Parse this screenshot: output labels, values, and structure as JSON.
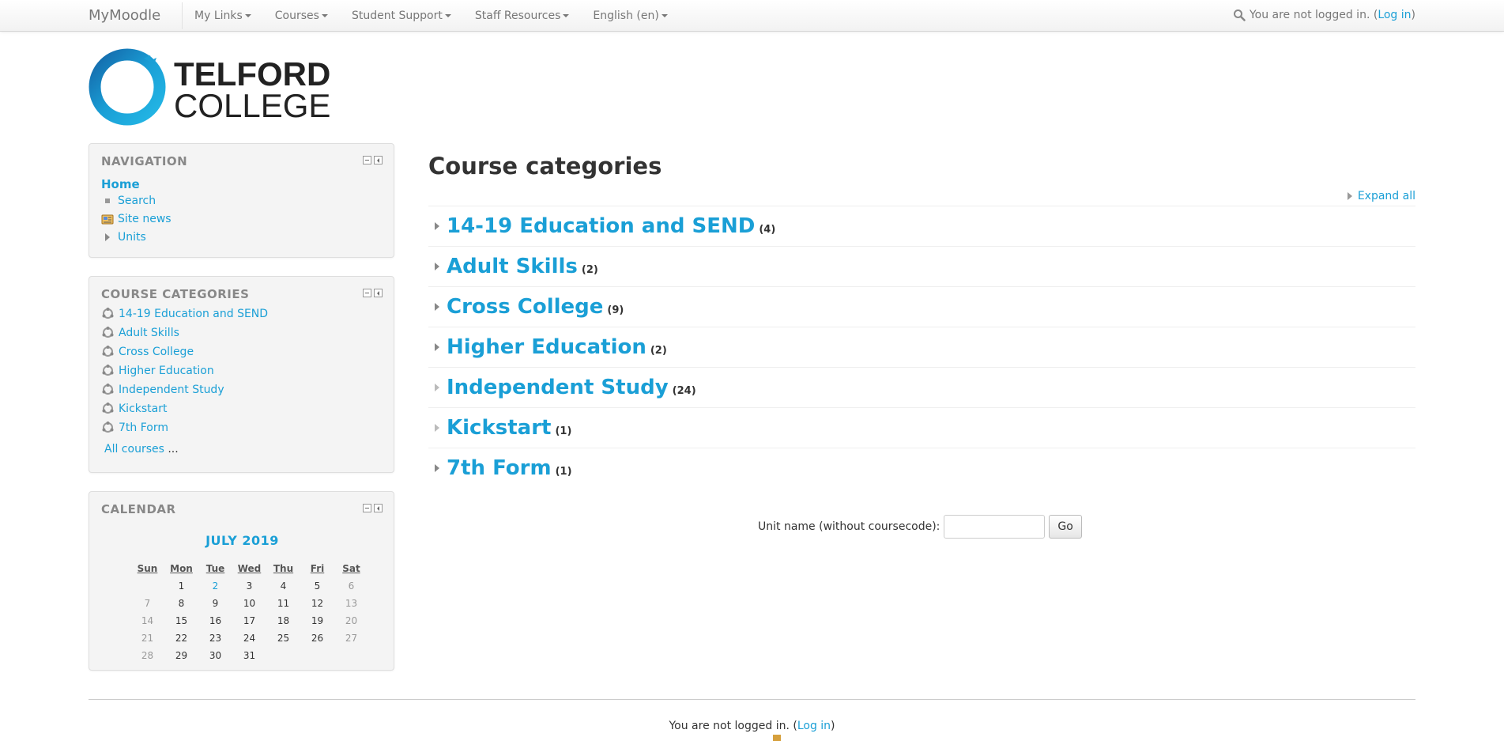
{
  "navbar": {
    "brand": "MyMoodle",
    "menu": [
      {
        "label": "My Links"
      },
      {
        "label": "Courses"
      },
      {
        "label": "Student Support"
      },
      {
        "label": "Staff Resources"
      },
      {
        "label": "English (en)"
      }
    ],
    "not_logged_prefix": "You are not logged in. (",
    "login_link": "Log in",
    "not_logged_suffix": ")"
  },
  "logo": {
    "line1": "TELFORD",
    "line2": "COLLEGE"
  },
  "navigation_block": {
    "title": "NAVIGATION",
    "home": "Home",
    "items": [
      {
        "label": "Search"
      },
      {
        "label": "Site news"
      },
      {
        "label": "Units"
      }
    ]
  },
  "categories_block": {
    "title": "COURSE CATEGORIES",
    "items": [
      {
        "label": "14-19 Education and SEND"
      },
      {
        "label": "Adult Skills"
      },
      {
        "label": "Cross College"
      },
      {
        "label": "Higher Education"
      },
      {
        "label": "Independent Study"
      },
      {
        "label": "Kickstart"
      },
      {
        "label": "7th Form"
      }
    ],
    "all_courses": "All courses",
    "all_courses_suffix": " ..."
  },
  "calendar_block": {
    "title": "CALENDAR",
    "month": "JULY 2019",
    "days": [
      "Sun",
      "Mon",
      "Tue",
      "Wed",
      "Thu",
      "Fri",
      "Sat"
    ],
    "weeks": [
      [
        "",
        "1",
        "2",
        "3",
        "4",
        "5",
        "6"
      ],
      [
        "7",
        "8",
        "9",
        "10",
        "11",
        "12",
        "13"
      ],
      [
        "14",
        "15",
        "16",
        "17",
        "18",
        "19",
        "20"
      ],
      [
        "21",
        "22",
        "23",
        "24",
        "25",
        "26",
        "27"
      ],
      [
        "28",
        "29",
        "30",
        "31",
        "",
        "",
        ""
      ]
    ],
    "today": "2"
  },
  "main": {
    "title": "Course categories",
    "expand_all": "Expand all",
    "categories": [
      {
        "name": "14-19 Education and SEND",
        "count": "(4)"
      },
      {
        "name": "Adult Skills",
        "count": "(2)"
      },
      {
        "name": "Cross College",
        "count": "(9)"
      },
      {
        "name": "Higher Education",
        "count": "(2)"
      },
      {
        "name": "Independent Study",
        "count": "(24)"
      },
      {
        "name": "Kickstart",
        "count": "(1)"
      },
      {
        "name": "7th Form",
        "count": "(1)"
      }
    ],
    "unit_search_label": "Unit name (without coursecode):",
    "unit_search_value": "",
    "go_label": "Go"
  },
  "footer": {
    "not_logged_prefix": "You are not logged in. (",
    "login_link": "Log in",
    "not_logged_suffix": ")"
  },
  "colors": {
    "link": "#1a9fd6",
    "logo_ring": "#1a9fd6",
    "logo_text": "#222222"
  }
}
